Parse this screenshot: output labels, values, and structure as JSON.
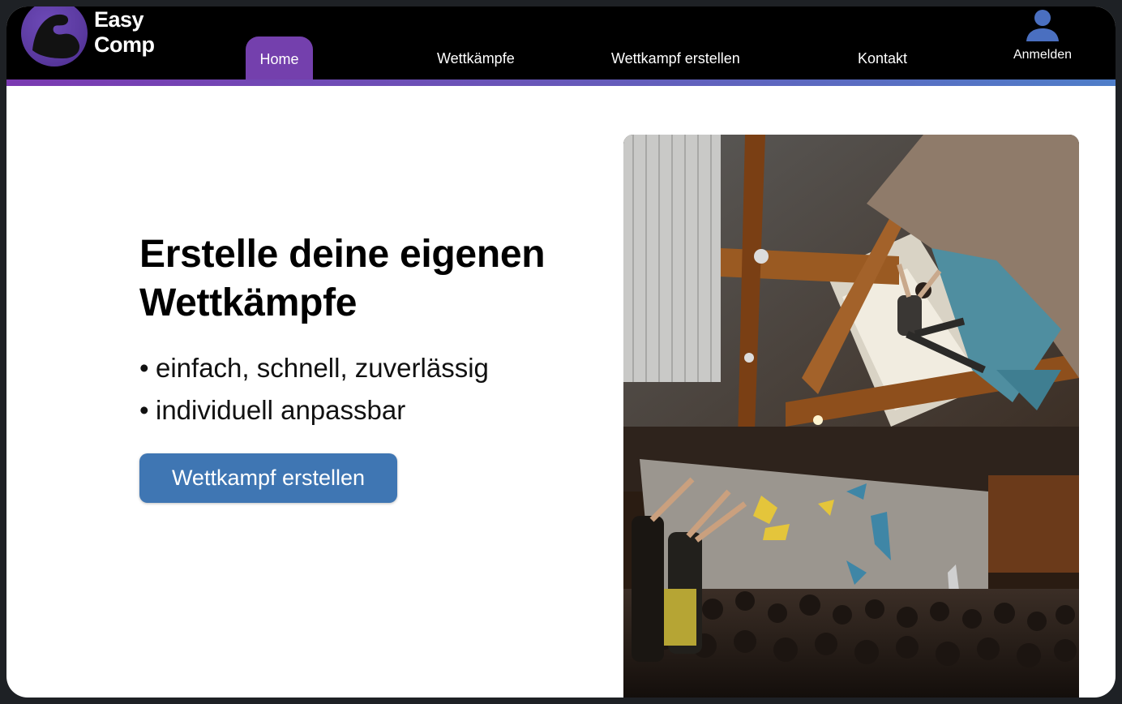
{
  "brand": {
    "line1": "Easy",
    "line2": "Comp",
    "accent": "#7440ad"
  },
  "nav": {
    "home": "Home",
    "wettkaempfe": "Wettkämpfe",
    "wettkampf_erstellen": "Wettkampf erstellen",
    "kontakt": "Kontakt",
    "anmelden": "Anmelden"
  },
  "hero": {
    "title_line1": "Erstelle deine eigenen",
    "title_line2": "Wettkämpfe",
    "bullets": [
      "einfach, schnell, zuverlässig",
      "individuell anpassbar"
    ],
    "bullet_char": "•",
    "cta_label": "Wettkampf erstellen",
    "cta_color": "#3f76b3"
  },
  "icons": {
    "logo": "flexed-arm-icon",
    "user": "user-icon"
  }
}
